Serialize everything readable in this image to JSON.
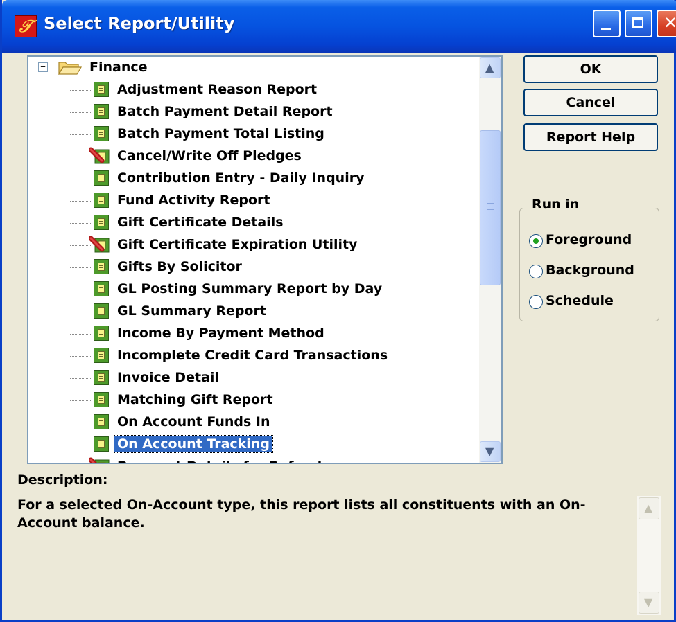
{
  "window": {
    "title": "Select Report/Utility",
    "app_icon": "𝒯"
  },
  "tree": {
    "folder": "Finance",
    "expander": "−",
    "items": [
      {
        "label": "Adjustment Reason Report",
        "icon": "report-icon"
      },
      {
        "label": "Batch Payment Detail Report",
        "icon": "report-icon"
      },
      {
        "label": "Batch Payment Total Listing",
        "icon": "report-icon"
      },
      {
        "label": "Cancel/Write Off Pledges",
        "icon": "utility-icon"
      },
      {
        "label": "Contribution Entry - Daily Inquiry",
        "icon": "report-icon"
      },
      {
        "label": "Fund Activity Report",
        "icon": "report-icon"
      },
      {
        "label": "Gift Certificate Details",
        "icon": "report-icon"
      },
      {
        "label": "Gift Certificate Expiration Utility",
        "icon": "utility-icon"
      },
      {
        "label": "Gifts By Solicitor",
        "icon": "report-icon"
      },
      {
        "label": "GL Posting Summary Report by Day",
        "icon": "report-icon"
      },
      {
        "label": "GL Summary Report",
        "icon": "report-icon"
      },
      {
        "label": "Income By Payment Method",
        "icon": "report-icon"
      },
      {
        "label": "Incomplete Credit Card Transactions",
        "icon": "report-icon"
      },
      {
        "label": "Invoice Detail",
        "icon": "report-icon"
      },
      {
        "label": "Matching Gift Report",
        "icon": "report-icon"
      },
      {
        "label": "On Account Funds In",
        "icon": "report-icon"
      },
      {
        "label": "On Account Tracking",
        "icon": "report-icon",
        "selected": true
      },
      {
        "label": "Payment Details for Refunds",
        "icon": "utility-icon"
      }
    ]
  },
  "buttons": {
    "ok": "OK",
    "cancel": "Cancel",
    "help": "Report Help"
  },
  "run_in": {
    "title": "Run in",
    "options": [
      "Foreground",
      "Background",
      "Schedule"
    ],
    "selected": "Foreground"
  },
  "description": {
    "label": "Description:",
    "text": "For a selected On-Account type, this report lists all constituents with an On-Account balance."
  },
  "colors": {
    "titlebar": "#0653e0",
    "selection": "#316ac5",
    "dialog_bg": "#ece9d8"
  }
}
